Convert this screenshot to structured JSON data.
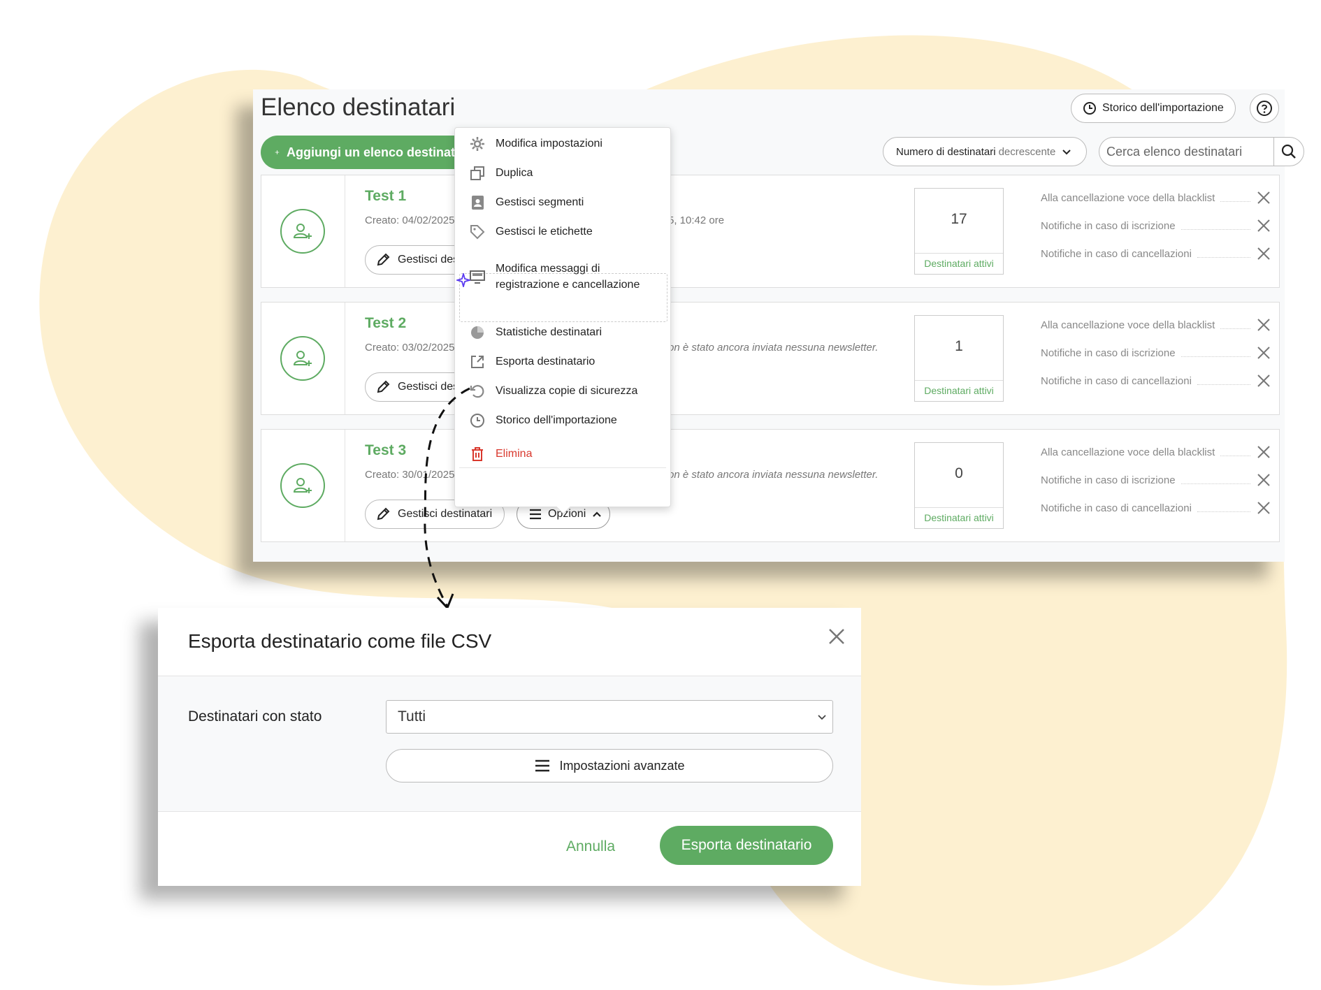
{
  "colors": {
    "accent": "#5eab62",
    "danger": "#d9382d",
    "blob": "#fdf0d0"
  },
  "header": {
    "title": "Elenco destinatari",
    "history_button": "Storico dell'importazione",
    "help_icon": "question-circle-icon"
  },
  "toolbar": {
    "add_button": "Aggiungi un elenco destinatari",
    "sort_label": "Numero di destinatari",
    "sort_order": "decrescente",
    "search_placeholder": "Cerca elenco destinatari"
  },
  "lists": [
    {
      "name": "Test 1",
      "created": "Creato: 04/02/2025",
      "info": "5, 10:42 ore",
      "count": "17",
      "count_label": "Destinatari attivi",
      "manage_label": "Gestisci destinatari",
      "settings": [
        "Alla cancellazione voce della blacklist",
        "Notifiche in caso di iscrizione",
        "Notifiche in caso di cancellazioni"
      ]
    },
    {
      "name": "Test 2",
      "created": "Creato: 03/02/2025",
      "info": "on è stato ancora inviata nessuna newsletter.",
      "count": "1",
      "count_label": "Destinatari attivi",
      "manage_label": "Gestisci destinatari",
      "settings": [
        "Alla cancellazione voce della blacklist",
        "Notifiche in caso di iscrizione",
        "Notifiche in caso di cancellazioni"
      ]
    },
    {
      "name": "Test 3",
      "created": "Creato: 30/01/2025",
      "info": "on è stato ancora inviata nessuna newsletter.",
      "count": "0",
      "count_label": "Destinatari attivi",
      "manage_label": "Gestisci destinatari",
      "options_label": "Opzioni",
      "settings": [
        "Alla cancellazione voce della blacklist",
        "Notifiche in caso di iscrizione",
        "Notifiche in caso di cancellazioni"
      ]
    }
  ],
  "dropdown": {
    "items": [
      {
        "label": "Modifica impostazioni",
        "icon": "gear-icon"
      },
      {
        "label": "Duplica",
        "icon": "duplicate-icon"
      },
      {
        "label": "Gestisci segmenti",
        "icon": "contacts-icon"
      },
      {
        "label": "Gestisci le etichette",
        "icon": "tag-icon"
      },
      {
        "label": "Modifica messaggi di",
        "label2": "registrazione e cancellazione",
        "icon": "monitor-icon"
      },
      {
        "label": "Statistiche destinatari",
        "icon": "pie-chart-icon"
      },
      {
        "label": "Esporta destinatario",
        "icon": "export-icon"
      },
      {
        "label": "Visualizza copie di sicurezza",
        "icon": "restore-icon"
      },
      {
        "label": "Storico dell'importazione",
        "icon": "clock-icon"
      },
      {
        "label": "Elimina",
        "icon": "trash-icon"
      }
    ]
  },
  "dialog": {
    "title": "Esporta destinatario come file CSV",
    "status_label": "Destinatari con stato",
    "status_value": "Tutti",
    "advanced_label": "Impostazioni avanzate",
    "cancel_label": "Annulla",
    "export_label": "Esporta destinatario"
  }
}
